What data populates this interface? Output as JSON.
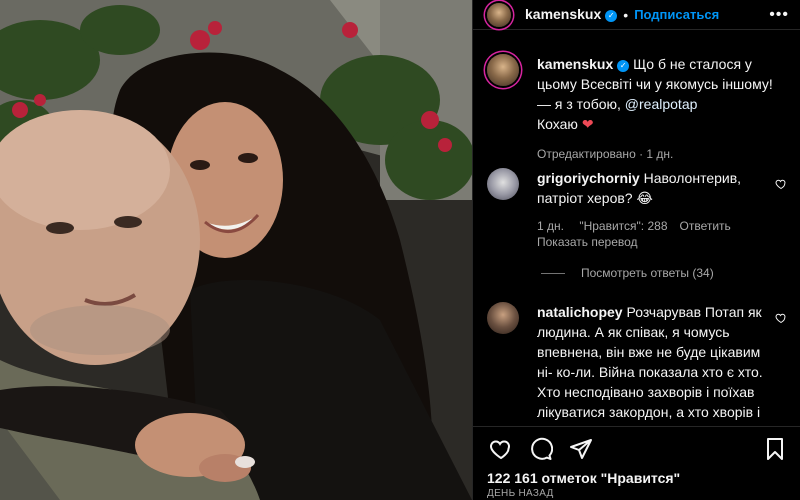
{
  "post": {
    "image_alt": "Photo of two people hugging"
  },
  "header": {
    "username": "kamenskux",
    "separator": "•",
    "follow_label": "Подписаться",
    "more_label": "•••"
  },
  "caption": {
    "username": "kamenskux",
    "text_1": "Що б не сталося у цьому Всесвіті чи у якомусь іншому! — я з тобою, ",
    "mention": "@realpotap",
    "text_2": "Кохаю ",
    "heart": "❤",
    "meta": "Отредактировано · 1 дн."
  },
  "comments": [
    {
      "username": "grigoriychorniy",
      "text": "Наволонтерив, патріот херов? 😂",
      "time": "1 дн.",
      "likes": "\"Нравится\": 288",
      "reply": "Показать перевод"
    },
    {
      "username": "natalichopey",
      "text": "Розчарував Потап як людина. А як співак, я чомусь впевнена, він вже не буде цікавим ні- ко-ли. Війна показала хто є хто. Хто несподівано захворів і поїхав лікуватися закордон, а хто хворів і хворіє та зараз на передовій зі"
    }
  ],
  "view_replies": "Посмотреть ответы (34)",
  "footer": {
    "likes": "122 161 отметок \"Нравится\"",
    "date": "ДЕНЬ НАЗАД"
  },
  "colors": {
    "accent": "#0095f6",
    "background": "#000000",
    "muted": "#a8a8a8",
    "heart": "#ed4956"
  }
}
